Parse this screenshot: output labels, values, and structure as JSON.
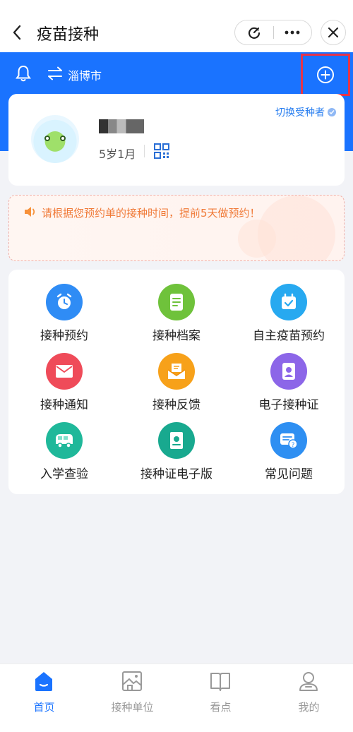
{
  "header": {
    "title": "疫苗接种"
  },
  "location": {
    "city": "淄博市"
  },
  "profile": {
    "switch_label": "切换受种者",
    "age": "5岁1月"
  },
  "notice": {
    "text": "请根据您预约单的接种时间，提前5天做预约！"
  },
  "services": [
    {
      "label": "接种预约",
      "icon": "alarm-clock-icon",
      "color": "#2f8cf5"
    },
    {
      "label": "接种档案",
      "icon": "document-icon",
      "color": "#6fc23b"
    },
    {
      "label": "自主疫苗预约",
      "icon": "calendar-check-icon",
      "color": "#27a9f0"
    },
    {
      "label": "接种通知",
      "icon": "mail-icon",
      "color": "#ef4b59"
    },
    {
      "label": "接种反馈",
      "icon": "feedback-mail-icon",
      "color": "#f7a11a"
    },
    {
      "label": "电子接种证",
      "icon": "id-card-icon",
      "color": "#8c66e8"
    },
    {
      "label": "入学查验",
      "icon": "school-bus-icon",
      "color": "#1fb89a"
    },
    {
      "label": "接种证电子版",
      "icon": "certificate-book-icon",
      "color": "#18a98f"
    },
    {
      "label": "常见问题",
      "icon": "question-chat-icon",
      "color": "#2e8ff2"
    }
  ],
  "tabs": [
    {
      "label": "首页",
      "icon": "home-icon",
      "active": true
    },
    {
      "label": "接种单位",
      "icon": "building-icon",
      "active": false
    },
    {
      "label": "看点",
      "icon": "book-icon",
      "active": false
    },
    {
      "label": "我的",
      "icon": "user-icon",
      "active": false
    }
  ],
  "colors": {
    "primary": "#1a73ff",
    "highlight_border": "#e5344a",
    "notice_text": "#f07a38"
  }
}
